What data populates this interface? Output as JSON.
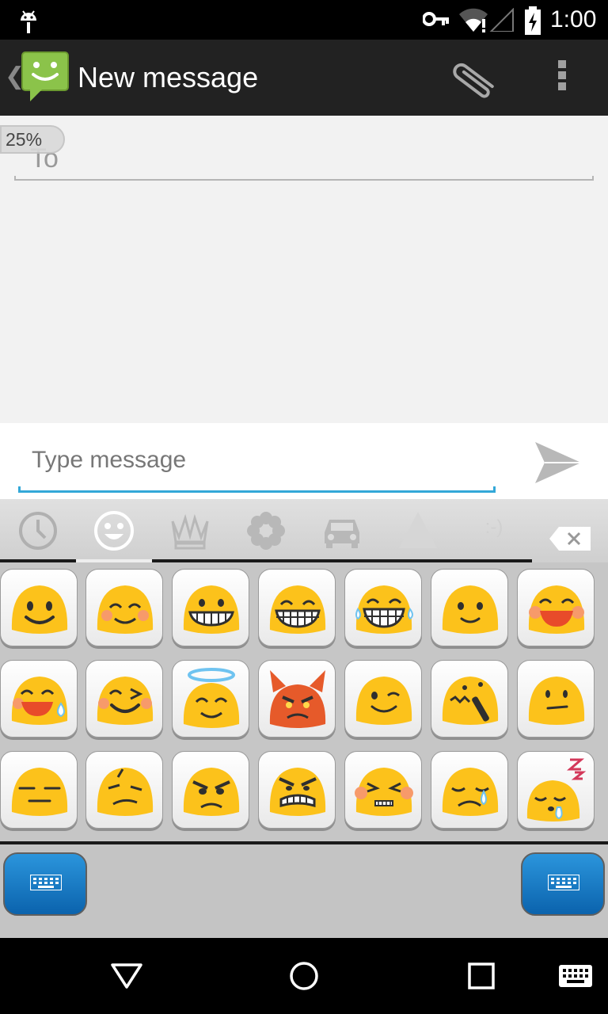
{
  "status_bar": {
    "time": "1:00",
    "icons": [
      "android-debug-icon",
      "vpn-key-icon",
      "wifi-alert-icon",
      "cell-signal-icon",
      "battery-charging-icon"
    ]
  },
  "action_bar": {
    "title": "New message",
    "icons": [
      "up-caret-icon",
      "messaging-app-icon",
      "paperclip-icon",
      "overflow-menu-icon"
    ]
  },
  "compose": {
    "to_label": "To",
    "overlay_badge": "25%"
  },
  "message_field": {
    "placeholder": "Type message",
    "send_icon": "send-icon"
  },
  "emoji_keyboard": {
    "tabs": [
      {
        "name": "recent",
        "icon": "clock-icon",
        "selected": false
      },
      {
        "name": "smileys",
        "icon": "smiley-icon",
        "selected": true
      },
      {
        "name": "objects",
        "icon": "crown-icon",
        "selected": false
      },
      {
        "name": "nature",
        "icon": "flower-icon",
        "selected": false
      },
      {
        "name": "places",
        "icon": "car-icon",
        "selected": false
      },
      {
        "name": "symbols",
        "icon": "triangle-icon",
        "selected": false
      },
      {
        "name": "emoticons",
        "label": ":-)",
        "selected": false
      },
      {
        "name": "delete",
        "icon": "backspace-icon",
        "selected": false
      }
    ],
    "emoji_rows": [
      [
        "smiling-face",
        "smiling-eyes-blush",
        "grinning-teeth",
        "grinning-smiling-eyes",
        "tears-of-joy",
        "slightly-smiling",
        "happy-laughing"
      ],
      [
        "laughing-sweat",
        "squinting-wink",
        "smiling-halo",
        "angry-devil",
        "winking-face",
        "confounded-face",
        "neutral-glance"
      ],
      [
        "expressionless",
        "confused-face",
        "angry-face",
        "grimacing-angry",
        "persevering-face",
        "crying-face",
        "sleeping-face"
      ]
    ],
    "bottom_keys": [
      "keyboard-switch-left",
      "keyboard-switch-right"
    ]
  },
  "navigation_bar": {
    "buttons": [
      "back-icon",
      "home-icon",
      "recents-icon",
      "keyboard-picker-icon"
    ]
  },
  "colors": {
    "emoji_yellow": "#fcc21b",
    "emoji_face_detail": "#2f2f2f",
    "devil_orange": "#e65a2a",
    "accent_blue": "#33a8d8",
    "messaging_green": "#8bc34a"
  }
}
